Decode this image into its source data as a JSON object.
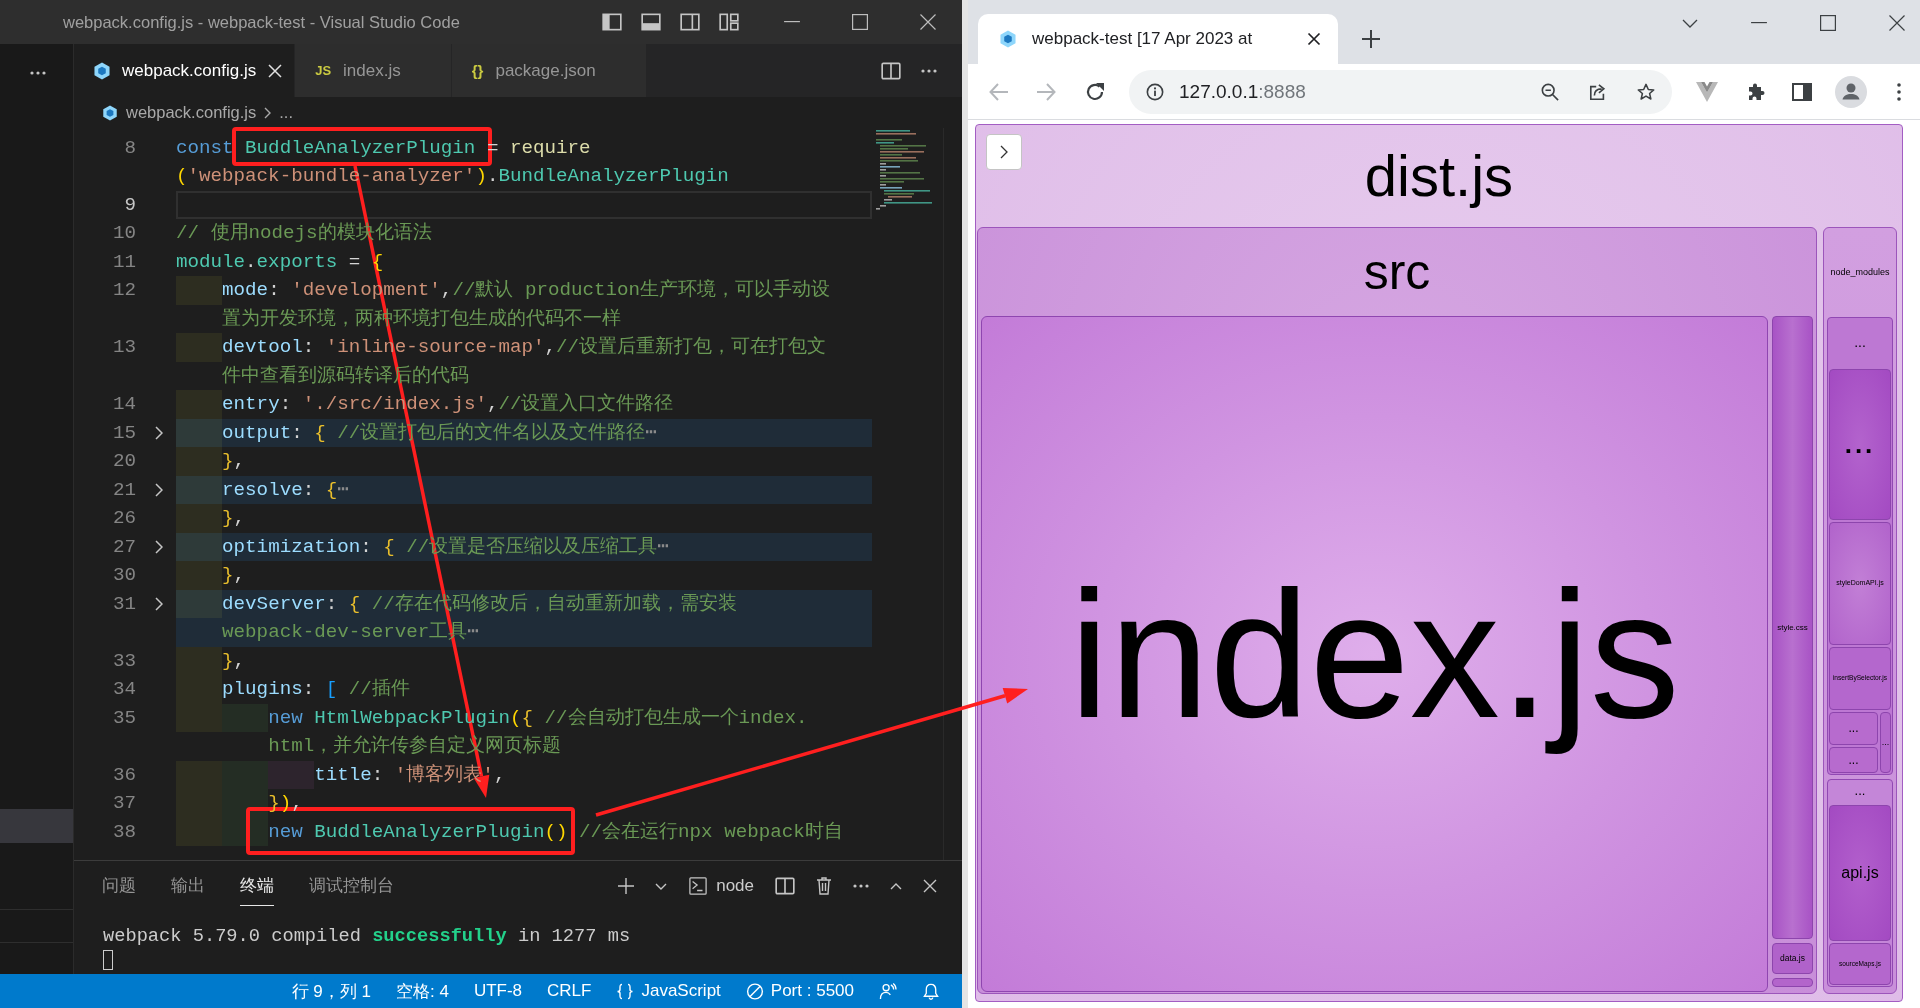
{
  "vscode": {
    "title": "webpack.config.js - webpack-test - Visual Studio Code",
    "tabs": [
      {
        "label": "webpack.config.js",
        "kind": "webpack",
        "selected": true
      },
      {
        "label": "index.js",
        "kind": "js",
        "glyph": "JS",
        "selected": false
      },
      {
        "label": "package.json",
        "kind": "json",
        "glyph": "{}",
        "selected": false
      }
    ],
    "breadcrumb": {
      "file": "webpack.config.js",
      "more": "..."
    },
    "editor": {
      "lines": [
        {
          "number": "8",
          "current": false,
          "folded": false,
          "rows": [
            {
              "tokens": [
                {
                  "text": "const ",
                  "kind": "keyword"
                },
                {
                  "text": "BuddleAnalyzerPlugin",
                  "kind": "class"
                },
                {
                  "text": " = ",
                  "kind": "punct"
                },
                {
                  "text": "require",
                  "kind": "function"
                }
              ]
            },
            {
              "tokens": [
                {
                  "text": "(",
                  "kind": "bracket1"
                },
                {
                  "text": "'webpack-bundle-analyzer'",
                  "kind": "string"
                },
                {
                  "text": ")",
                  "kind": "bracket1"
                },
                {
                  "text": ".",
                  "kind": "punct"
                },
                {
                  "text": "BundleAnalyzerPlugin",
                  "kind": "class"
                }
              ]
            }
          ]
        },
        {
          "number": "9",
          "current": true,
          "folded": false
        },
        {
          "number": "10",
          "current": false,
          "folded": false,
          "rows": [
            {
              "tokens": [
                {
                  "text": "// 使用nodejs的模块化语法",
                  "kind": "comment"
                }
              ]
            }
          ]
        },
        {
          "number": "11",
          "current": false,
          "folded": false,
          "rows": [
            {
              "tokens": [
                {
                  "text": "module",
                  "kind": "class"
                },
                {
                  "text": ".",
                  "kind": "punct"
                },
                {
                  "text": "exports",
                  "kind": "class"
                },
                {
                  "text": " = ",
                  "kind": "punct"
                },
                {
                  "text": "{",
                  "kind": "bracket1"
                }
              ]
            }
          ],
          "children": [
            {
              "number": "12",
              "current": false,
              "folded": false,
              "rows": [
                {
                  "tokens": [
                    {
                      "text": "mode",
                      "kind": "variable"
                    },
                    {
                      "text": ": ",
                      "kind": "punct"
                    },
                    {
                      "text": "'development'",
                      "kind": "string"
                    },
                    {
                      "text": ",",
                      "kind": "punct"
                    },
                    {
                      "text": "//默认 production生产环境，可以手动设",
                      "kind": "comment"
                    }
                  ]
                },
                {
                  "tokens": [
                    {
                      "text": "置为开发环境，两种环境打包生成的代码不一样",
                      "kind": "comment"
                    }
                  ]
                }
              ]
            },
            {
              "number": "13",
              "current": false,
              "folded": false,
              "rows": [
                {
                  "tokens": [
                    {
                      "text": "devtool",
                      "kind": "variable"
                    },
                    {
                      "text": ": ",
                      "kind": "punct"
                    },
                    {
                      "text": "'inline-source-map'",
                      "kind": "string"
                    },
                    {
                      "text": ",",
                      "kind": "punct"
                    },
                    {
                      "text": "//设置后重新打包，可在打包文",
                      "kind": "comment"
                    }
                  ]
                },
                {
                  "tokens": [
                    {
                      "text": "件中查看到源码转译后的代码",
                      "kind": "comment"
                    }
                  ]
                }
              ]
            },
            {
              "number": "14",
              "current": false,
              "folded": false,
              "rows": [
                {
                  "tokens": [
                    {
                      "text": "entry",
                      "kind": "variable"
                    },
                    {
                      "text": ": ",
                      "kind": "punct"
                    },
                    {
                      "text": "'./src/index.js'",
                      "kind": "string"
                    },
                    {
                      "text": ",",
                      "kind": "punct"
                    },
                    {
                      "text": "//设置入口文件路径",
                      "kind": "comment"
                    }
                  ]
                }
              ]
            },
            {
              "number": "15",
              "current": false,
              "folded": true,
              "rows": [
                {
                  "tokens": [
                    {
                      "text": "output",
                      "kind": "variable"
                    },
                    {
                      "text": ": ",
                      "kind": "punct"
                    },
                    {
                      "text": "{",
                      "kind": "bracket2"
                    },
                    {
                      "text": " //设置打包后的文件名以及文件路径",
                      "kind": "comment"
                    },
                    {
                      "text": "⋯",
                      "kind": "fold"
                    }
                  ]
                }
              ]
            },
            {
              "number": "20",
              "current": false,
              "folded": false,
              "rows": [
                {
                  "tokens": [
                    {
                      "text": "}",
                      "kind": "bracket2"
                    },
                    {
                      "text": ",",
                      "kind": "punct"
                    }
                  ]
                }
              ]
            },
            {
              "number": "21",
              "current": false,
              "folded": true,
              "rows": [
                {
                  "tokens": [
                    {
                      "text": "resolve",
                      "kind": "variable"
                    },
                    {
                      "text": ": ",
                      "kind": "punct"
                    },
                    {
                      "text": "{",
                      "kind": "bracket2"
                    },
                    {
                      "text": "⋯",
                      "kind": "fold"
                    }
                  ]
                }
              ]
            },
            {
              "number": "26",
              "current": false,
              "folded": false,
              "rows": [
                {
                  "tokens": [
                    {
                      "text": "}",
                      "kind": "bracket2"
                    },
                    {
                      "text": ",",
                      "kind": "punct"
                    }
                  ]
                }
              ]
            },
            {
              "number": "27",
              "current": false,
              "folded": true,
              "rows": [
                {
                  "tokens": [
                    {
                      "text": "optimization",
                      "kind": "variable"
                    },
                    {
                      "text": ": ",
                      "kind": "punct"
                    },
                    {
                      "text": "{",
                      "kind": "bracket2"
                    },
                    {
                      "text": " //设置是否压缩以及压缩工具",
                      "kind": "comment"
                    },
                    {
                      "text": "⋯",
                      "kind": "fold"
                    }
                  ]
                }
              ]
            },
            {
              "number": "30",
              "current": false,
              "folded": false,
              "rows": [
                {
                  "tokens": [
                    {
                      "text": "}",
                      "kind": "bracket2"
                    },
                    {
                      "text": ",",
                      "kind": "punct"
                    }
                  ]
                }
              ]
            },
            {
              "number": "31",
              "current": false,
              "folded": true,
              "rows": [
                {
                  "tokens": [
                    {
                      "text": "devServer",
                      "kind": "variable"
                    },
                    {
                      "text": ": ",
                      "kind": "punct"
                    },
                    {
                      "text": "{",
                      "kind": "bracket2"
                    },
                    {
                      "text": " //存在代码修改后，自动重新加载，需安装",
                      "kind": "comment"
                    }
                  ]
                },
                {
                  "tokens": [
                    {
                      "text": "webpack-dev-server工具",
                      "kind": "comment"
                    },
                    {
                      "text": "⋯",
                      "kind": "fold"
                    }
                  ]
                }
              ]
            },
            {
              "number": "33",
              "current": false,
              "folded": false,
              "rows": [
                {
                  "tokens": [
                    {
                      "text": "}",
                      "kind": "bracket2"
                    },
                    {
                      "text": ",",
                      "kind": "punct"
                    }
                  ]
                }
              ]
            },
            {
              "number": "34",
              "current": false,
              "folded": false,
              "rows": [
                {
                  "tokens": [
                    {
                      "text": "plugins",
                      "kind": "variable"
                    },
                    {
                      "text": ": ",
                      "kind": "punct"
                    },
                    {
                      "text": "[",
                      "kind": "bracket3"
                    },
                    {
                      "text": " //插件",
                      "kind": "comment"
                    }
                  ]
                }
              ],
              "children": [
                {
                  "number": "35",
                  "current": false,
                  "folded": false,
                  "rows": [
                    {
                      "tokens": [
                        {
                          "text": "new ",
                          "kind": "keyword"
                        },
                        {
                          "text": "HtmlWebpackPlugin",
                          "kind": "class"
                        },
                        {
                          "text": "(",
                          "kind": "bracket1"
                        },
                        {
                          "text": "{",
                          "kind": "bracket2"
                        },
                        {
                          "text": " //会自动打包生成一个index.",
                          "kind": "comment"
                        }
                      ]
                    },
                    {
                      "tokens": [
                        {
                          "text": "html，并允许传参自定义网页标题",
                          "kind": "comment"
                        }
                      ]
                    }
                  ],
                  "children": [
                    {
                      "number": "36",
                      "current": false,
                      "folded": false,
                      "rows": [
                        {
                          "tokens": [
                            {
                              "text": "title",
                              "kind": "variable"
                            },
                            {
                              "text": ": ",
                              "kind": "punct"
                            },
                            {
                              "text": "'博客列表'",
                              "kind": "string"
                            },
                            {
                              "text": ",",
                              "kind": "punct"
                            }
                          ]
                        }
                      ]
                    }
                  ]
                },
                {
                  "number": "37",
                  "current": false,
                  "folded": false,
                  "rows": [
                    {
                      "tokens": [
                        {
                          "text": "}",
                          "kind": "bracket2"
                        },
                        {
                          "text": ")",
                          "kind": "bracket1"
                        },
                        {
                          "text": ",",
                          "kind": "punct"
                        }
                      ]
                    }
                  ]
                },
                {
                  "number": "38",
                  "current": false,
                  "folded": false,
                  "rows": [
                    {
                      "tokens": [
                        {
                          "text": "new ",
                          "kind": "keyword"
                        },
                        {
                          "text": "BuddleAnalyzerPlugin",
                          "kind": "class"
                        },
                        {
                          "text": "()",
                          "kind": "bracket1"
                        },
                        {
                          "text": " //会在运行npx webpack时自",
                          "kind": "comment"
                        }
                      ]
                    }
                  ]
                }
              ]
            }
          ]
        }
      ]
    },
    "panel": {
      "tabs": [
        {
          "label": "问题",
          "selected": false
        },
        {
          "label": "输出",
          "selected": false
        },
        {
          "label": "终端",
          "selected": true
        },
        {
          "label": "调试控制台",
          "selected": false
        }
      ],
      "terminal_name": "node",
      "terminal_lines": [
        [
          {
            "text": "webpack 5.79.0 compiled ",
            "kind": "plain"
          },
          {
            "text": "successfully",
            "kind": "success"
          },
          {
            "text": " in 1277 ms",
            "kind": "plain"
          }
        ]
      ]
    },
    "status_bar": [
      {
        "kind": "text",
        "text": "行 9，列 1"
      },
      {
        "kind": "text",
        "text": "空格: 4"
      },
      {
        "kind": "text",
        "text": "UTF-8"
      },
      {
        "kind": "text",
        "text": "CRLF"
      },
      {
        "kind": "language",
        "text": "JavaScript"
      },
      {
        "kind": "port",
        "text": "Port : 5500"
      }
    ]
  },
  "browser": {
    "tab": {
      "title": "webpack-test [17 Apr 2023 at",
      "selected": true
    },
    "toolbar": {
      "back": {
        "disabled": true
      },
      "forward": {
        "disabled": true
      }
    },
    "address": {
      "host": "127.0.0.1",
      "port": ":8888"
    },
    "treemap": {
      "label": "dist.js",
      "children": [
        {
          "label": "src",
          "children": [
            {
              "label": "index.js"
            },
            {
              "label": "style.css"
            },
            {
              "label": "data.js"
            }
          ]
        },
        {
          "label": "node_modules",
          "children": [
            {
              "label": "...",
              "children": [
                {
                  "label": "..."
                },
                {
                  "label": "styleDomAPI.js"
                },
                {
                  "label": "insertBySelector.js"
                },
                {
                  "label": "..."
                },
                {
                  "label": "..."
                },
                {
                  "label": "..."
                }
              ]
            },
            {
              "label": "...",
              "children": [
                {
                  "label": "api.js"
                },
                {
                  "label": "sourceMaps.js"
                }
              ]
            }
          ]
        }
      ]
    }
  }
}
